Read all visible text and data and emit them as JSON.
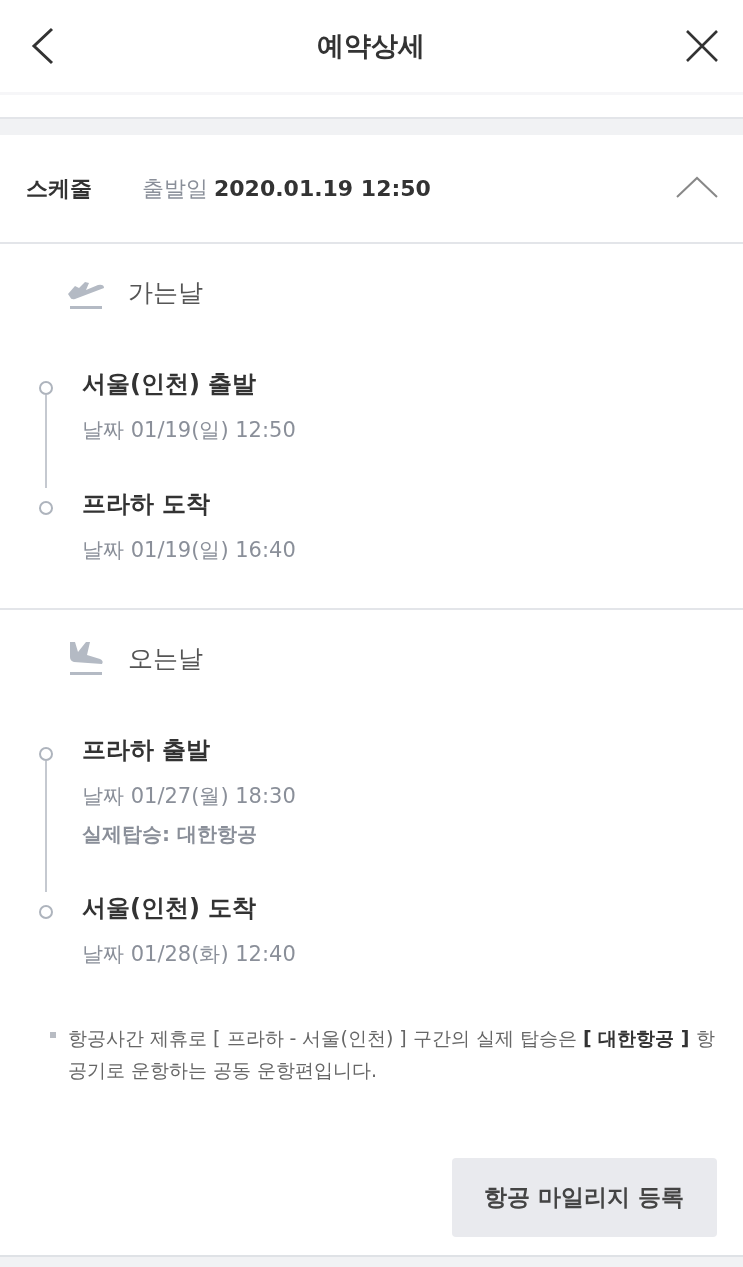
{
  "header": {
    "title": "예약상세"
  },
  "schedule": {
    "label": "스케줄",
    "date_label": "출발일",
    "date_value": "2020.01.19 12:50",
    "expanded": true
  },
  "legs": [
    {
      "kind": "departure",
      "title": "가는날",
      "stops": [
        {
          "title": "서울(인천) 출발",
          "date": "날짜 01/19(일) 12:50"
        },
        {
          "title": "프라하 도착",
          "date": "날짜 01/19(일) 16:40"
        }
      ]
    },
    {
      "kind": "arrival",
      "title": "오는날",
      "stops": [
        {
          "title": "프라하 출발",
          "date": "날짜 01/27(월) 18:30",
          "operator": "실제탑승: 대한항공"
        },
        {
          "title": "서울(인천) 도착",
          "date": "날짜 01/28(화) 12:40"
        }
      ]
    }
  ],
  "note": "항공사간 제휴로 [ 프라하 - 서울(인천) ] 구간의 실제 탑승은 **[ 대한항공 ]** 항공기로 운항하는 공동 운항편입니다.",
  "mileage_button": "항공 마일리지 등록"
}
